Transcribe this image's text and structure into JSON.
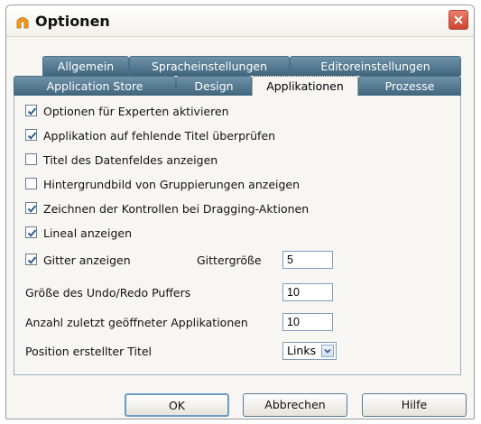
{
  "window": {
    "title": "Optionen"
  },
  "tabs": {
    "row1": [
      "Allgemein",
      "Spracheinstellungen",
      "Editoreinstellungen"
    ],
    "row2": [
      "Application Store",
      "Design",
      "Applikationen",
      "Prozesse"
    ],
    "selected": "Applikationen"
  },
  "options": {
    "expert": "Optionen für Experten aktivieren",
    "check_titles": "Applikation auf fehlende Titel überprüfen",
    "show_field_title": "Titel des Datenfeldes anzeigen",
    "group_bg": "Hintergrundbild von Gruppierungen anzeigen",
    "drag_draw": "Zeichnen der Kontrollen bei Dragging-Aktionen",
    "ruler": "Lineal anzeigen",
    "grid": "Gitter anzeigen",
    "grid_size_label": "Gittergröße",
    "grid_size_value": "5",
    "undo_label": "Größe des Undo/Redo Puffers",
    "undo_value": "10",
    "recent_label": "Anzahl zuletzt geöffneter Applikationen",
    "recent_value": "10",
    "title_pos_label": "Position erstellter Titel",
    "title_pos_value": "Links"
  },
  "checked": {
    "expert": true,
    "check_titles": true,
    "show_field_title": false,
    "group_bg": false,
    "drag_draw": true,
    "ruler": true,
    "grid": true
  },
  "buttons": {
    "ok": "OK",
    "cancel": "Abbrechen",
    "help": "Hilfe"
  }
}
